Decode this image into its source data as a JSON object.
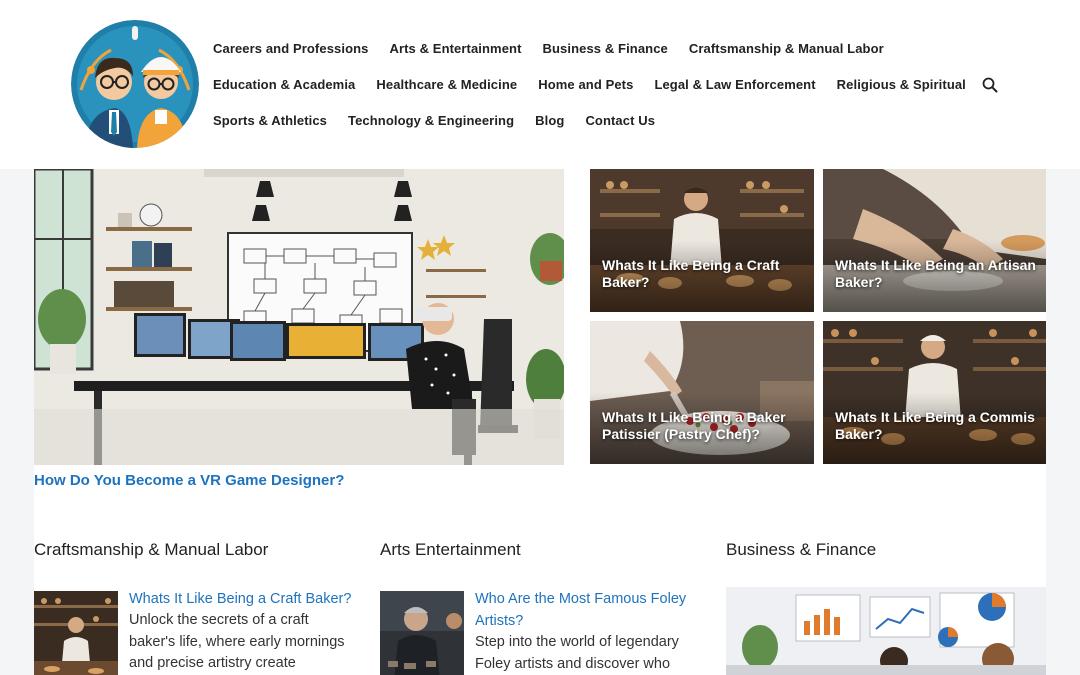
{
  "nav": {
    "row1": [
      "Careers and Professions",
      "Arts & Entertainment",
      "Business & Finance",
      "Craftsmanship & Manual Labor"
    ],
    "row2": [
      "Education & Academia",
      "Healthcare & Medicine",
      "Home and Pets",
      "Legal & Law Enforcement",
      "Religious & Spiritual"
    ],
    "row3": [
      "Sports & Athletics",
      "Technology & Engineering",
      "Blog",
      "Contact Us"
    ]
  },
  "featured": {
    "title": "How Do You Become a VR Game Designer?"
  },
  "cards": [
    {
      "title": "Whats It Like Being a Craft Baker?"
    },
    {
      "title": "Whats It Like Being an Artisan Baker?"
    },
    {
      "title": "Whats It Like Being a Baker Patissier (Pastry Chef)?"
    },
    {
      "title": "Whats It Like Being a Commis Baker?"
    }
  ],
  "sections": [
    {
      "title": "Craftsmanship & Manual Labor",
      "post": {
        "title": "Whats It Like Being a Craft Baker?",
        "excerpt": "Unlock the secrets of a craft baker's life, where early mornings and precise artistry create"
      }
    },
    {
      "title": "Arts Entertainment",
      "post": {
        "title": "Who Are the Most Famous Foley Artists?",
        "excerpt": "Step into the world of legendary Foley artists and discover who"
      }
    },
    {
      "title": "Business & Finance"
    }
  ],
  "colors": {
    "link": "#1e73be",
    "header_bg": "#ffffff",
    "page_bg": "#f4f5f7"
  },
  "icons": {
    "search": "magnifier",
    "logo": "two-professionals-avatar"
  }
}
